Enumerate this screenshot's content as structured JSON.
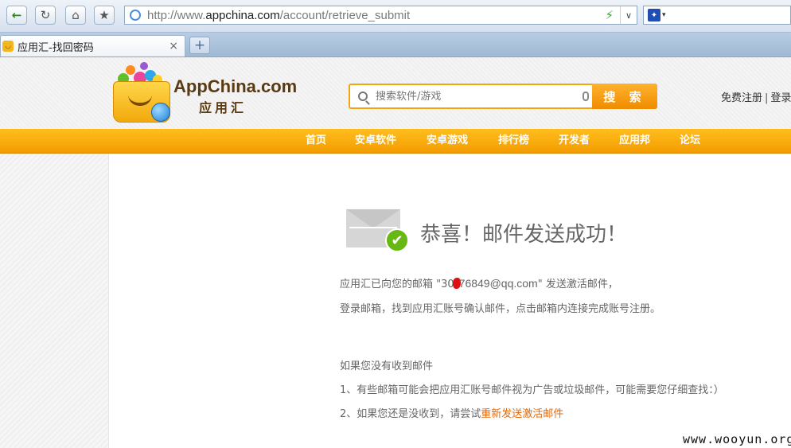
{
  "browser": {
    "url_scheme": "http://www.",
    "url_host": "appchina.com",
    "url_path": "/account/retrieve_submit",
    "tab_title": "应用汇-找回密码",
    "tab_close": "×",
    "new_tab": "+"
  },
  "header": {
    "logo_text": "AppChina.com",
    "logo_subtext": "应用汇",
    "search_placeholder": "搜索软件/游戏",
    "search_button": "搜 索",
    "register_link": "免费注册",
    "separator": "|",
    "login_link": "登录"
  },
  "nav": {
    "items": [
      "首页",
      "安卓软件",
      "安卓游戏",
      "排行榜",
      "开发者",
      "应用邦",
      "论坛"
    ]
  },
  "content": {
    "success_title": "恭喜！邮件发送成功！",
    "line1_prefix": "应用汇已向您的邮箱 \"30",
    "line1_email_rest": "76849@qq.com",
    "line1_suffix": "\" 发送激活邮件，",
    "line2": "登录邮箱，找到应用汇账号确认邮件，点击邮箱内连接完成账号注册。",
    "not_received_title": "如果您没有收到邮件",
    "tip1": "1、有些邮箱可能会把应用汇账号邮件视为广告或垃圾邮件，可能需要您仔细查找：）",
    "tip2_prefix": "2、如果您还是没收到，请尝试",
    "tip2_link": "重新发送激活邮件"
  },
  "watermark": "www.wooyun.org",
  "colors": {
    "accent_orange": "#f39c00",
    "link_orange": "#e06a10",
    "success_green": "#67b812"
  }
}
